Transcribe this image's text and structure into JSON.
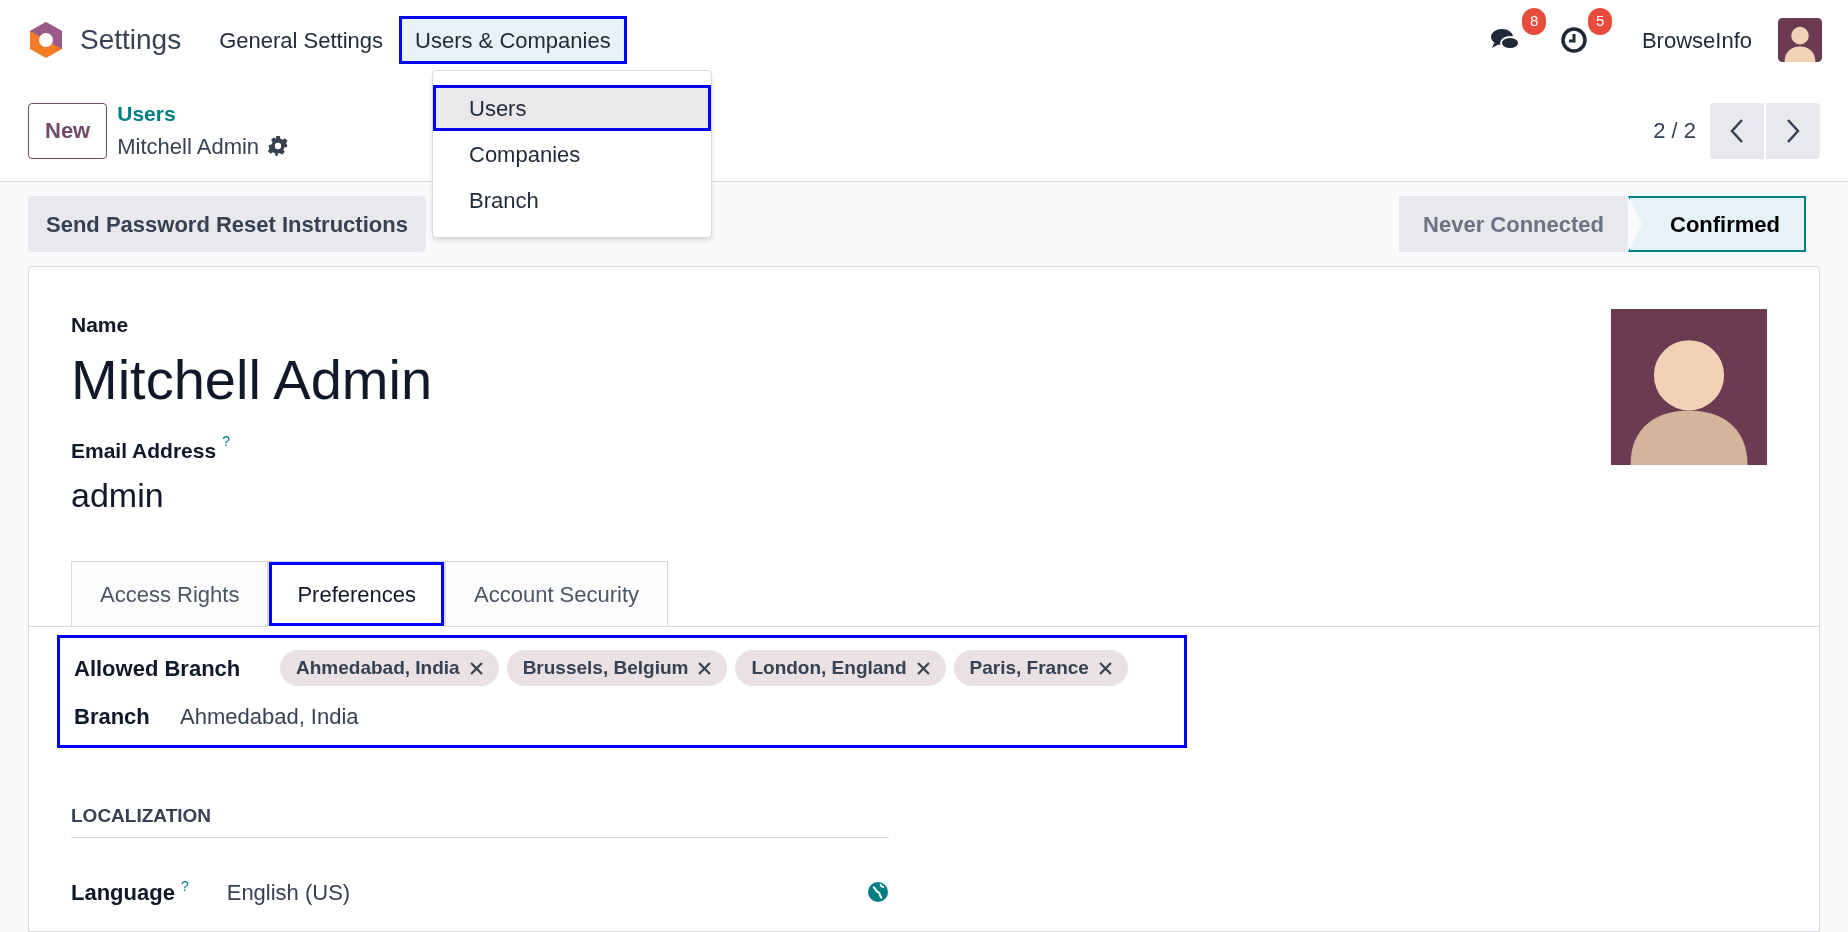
{
  "navbar": {
    "app_name": "Settings",
    "menus": [
      {
        "label": "General Settings",
        "selected": false,
        "highlighted": false
      },
      {
        "label": "Users & Companies",
        "selected": true,
        "highlighted": true
      }
    ],
    "messages_count": "8",
    "activities_count": "5",
    "company": "BrowseInfo"
  },
  "dropdown": {
    "items": [
      {
        "label": "Users",
        "selected": true,
        "highlighted": true
      },
      {
        "label": "Companies",
        "selected": false,
        "highlighted": false
      },
      {
        "label": "Branch",
        "selected": false,
        "highlighted": false
      }
    ]
  },
  "control_panel": {
    "new_button": "New",
    "breadcrumb": "Users",
    "record": "Mitchell Admin",
    "pager": "2 / 2"
  },
  "action_button": "Send Password Reset Instructions",
  "status_steps": [
    {
      "label": "Never Connected",
      "selected": false
    },
    {
      "label": "Confirmed",
      "selected": true
    }
  ],
  "form": {
    "name_label": "Name",
    "name": "Mitchell Admin",
    "email_label": "Email Address",
    "email_help": "?",
    "email": "admin",
    "tabs": [
      {
        "label": "Access Rights",
        "selected": false,
        "highlighted": false
      },
      {
        "label": "Preferences",
        "selected": true,
        "highlighted": true
      },
      {
        "label": "Account Security",
        "selected": false,
        "highlighted": false
      }
    ],
    "branch_group": {
      "highlighted": true,
      "allowed_label": "Allowed Branch",
      "allowed_tags": [
        "Ahmedabad, India",
        "Brussels, Belgium",
        "London, England",
        "Paris, France"
      ],
      "branch_label": "Branch",
      "branch": "Ahmedabad, India"
    },
    "section_title": "LOCALIZATION",
    "language_label": "Language",
    "language_help": "?",
    "language": "English (US)"
  }
}
